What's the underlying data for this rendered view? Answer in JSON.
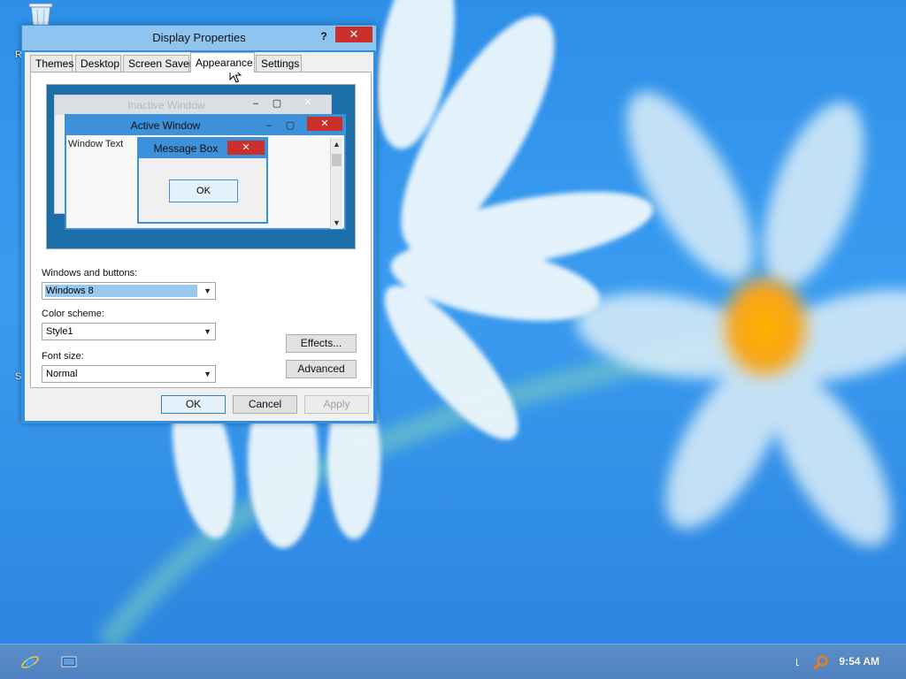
{
  "desktop": {
    "icons": [
      {
        "name": "recycle-bin-icon"
      }
    ],
    "edge_labels": [
      "R",
      "S"
    ]
  },
  "dialog": {
    "title": "Display Properties",
    "help_label": "?",
    "close_label": "✕",
    "tabs": [
      {
        "label": "Themes"
      },
      {
        "label": "Desktop"
      },
      {
        "label": "Screen Saver"
      },
      {
        "label": "Appearance"
      },
      {
        "label": "Settings"
      }
    ],
    "active_tab": "Appearance",
    "preview": {
      "inactive_title": "Inactive Window",
      "active_title": "Active Window",
      "window_text": "Window Text",
      "message_box_title": "Message Box",
      "ok_label": "OK",
      "minimize_glyph": "–",
      "maximize_glyph": "▢",
      "close_glyph": "✕"
    },
    "windows_and_buttons": {
      "label": "Windows and buttons:",
      "value": "Windows 8"
    },
    "color_scheme": {
      "label": "Color scheme:",
      "value": "Style1"
    },
    "font_size": {
      "label": "Font size:",
      "value": "Normal"
    },
    "effects_label": "Effects...",
    "advanced_label": "Advanced",
    "ok_label": "OK",
    "cancel_label": "Cancel",
    "apply_label": "Apply"
  },
  "taskbar": {
    "time": "9:54 AM"
  },
  "colors": {
    "accent": "#3d91db",
    "close_red": "#c9302c",
    "preview_bg": "#1b6ea8"
  }
}
